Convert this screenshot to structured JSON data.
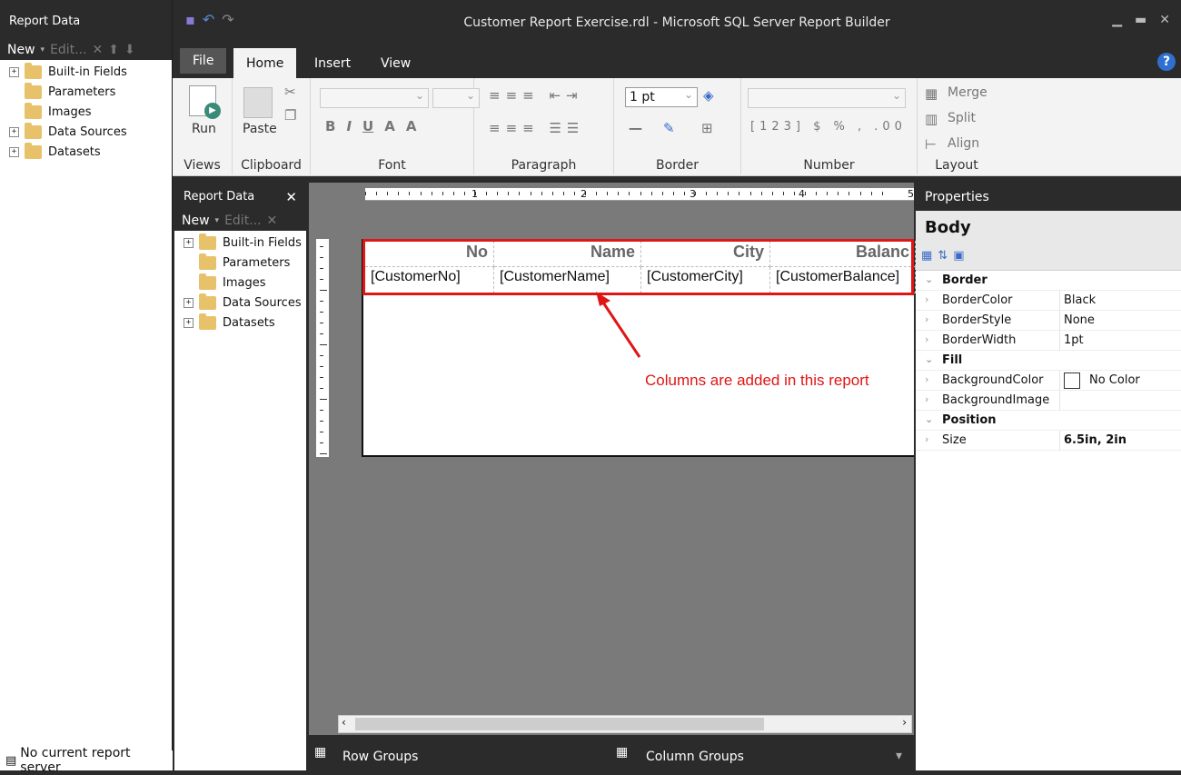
{
  "window": {
    "title": "Customer Report Exercise.rdl - Microsoft SQL Server Report Builder"
  },
  "tabs": [
    "File",
    "Home",
    "Insert",
    "View"
  ],
  "ribbon": {
    "run": "Run",
    "views": "Views",
    "paste": "Paste",
    "clipboard": "Clipboard",
    "font": "Font",
    "paragraph": "Paragraph",
    "border_width": "1 pt",
    "border": "Border",
    "number": "Number",
    "merge": "Merge",
    "split": "Split",
    "align": "Align",
    "layout": "Layout"
  },
  "outer_panel": {
    "title": "Report Data",
    "new": "New",
    "edit": "Edit...",
    "items": [
      "Built-in Fields",
      "Parameters",
      "Images",
      "Data Sources",
      "Datasets"
    ]
  },
  "inner_panel": {
    "title": "Report Data",
    "new": "New",
    "edit": "Edit...",
    "items": [
      "Built-in Fields",
      "Parameters",
      "Images",
      "Data Sources",
      "Datasets"
    ]
  },
  "report": {
    "headers": [
      "No",
      "Name",
      "City",
      "Balanc"
    ],
    "fields": [
      "[CustomerNo]",
      "[CustomerName]",
      "[CustomerCity]",
      "[CustomerBalance]"
    ],
    "ruler": [
      "1",
      "2",
      "3",
      "4",
      "5"
    ],
    "annotation": "Columns are added in this report"
  },
  "groups": {
    "row": "Row Groups",
    "column": "Column Groups"
  },
  "status": "No current report server",
  "properties": {
    "title": "Properties",
    "object": "Body",
    "rows": [
      {
        "cat": true,
        "k": "Border"
      },
      {
        "k": "BorderColor",
        "v": "Black"
      },
      {
        "k": "BorderStyle",
        "v": "None"
      },
      {
        "k": "BorderWidth",
        "v": "1pt"
      },
      {
        "cat": true,
        "k": "Fill"
      },
      {
        "k": "BackgroundColor",
        "v": "No Color"
      },
      {
        "k": "BackgroundImage",
        "v": ""
      },
      {
        "cat": true,
        "k": "Position"
      },
      {
        "k": "Size",
        "v": "6.5in, 2in"
      }
    ]
  },
  "colors": {
    "accent_red": "#e01515",
    "help_blue": "#2f6fd0"
  }
}
